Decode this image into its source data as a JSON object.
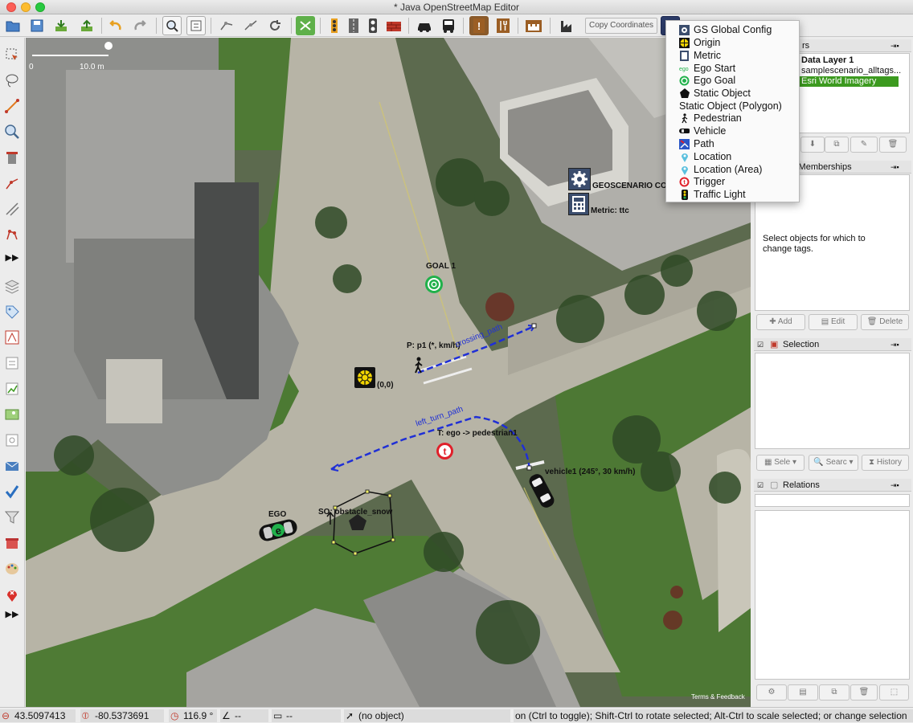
{
  "window": {
    "title": "* Java OpenStreetMap Editor"
  },
  "toolbar": {
    "copy_coordinates_label": "Copy Coordinates"
  },
  "map": {
    "scale_start": "0",
    "scale_end": "10.0 m",
    "labels": {
      "goal": "GOAL 1",
      "geoscenario_config": "GEOSCENARIO CO",
      "metric": "Metric: ttc",
      "pedestrian": "P: p1 (*, km/h)",
      "crossing_path": "crossing_path",
      "origin": "(0,0)",
      "left_turn_path": "left_turn_path",
      "trigger": "T: ego -> pedestrian1",
      "vehicle": "vehicle1 (245°, 30 km/h)",
      "ego": "EGO",
      "static_object": "SO: obstacle_snow",
      "attribution": "Terms & Feedback"
    }
  },
  "dropdown_menu": {
    "items": [
      {
        "label": "GS Global Config",
        "icon": "gear-icon",
        "indent": true
      },
      {
        "label": "Origin",
        "icon": "origin-icon",
        "indent": true
      },
      {
        "label": "Metric",
        "icon": "calculator-icon",
        "indent": true
      },
      {
        "label": "Ego Start",
        "icon": "ego-start-icon",
        "indent": true
      },
      {
        "label": "Ego Goal",
        "icon": "target-icon",
        "indent": true
      },
      {
        "label": "Static Object",
        "icon": "pentagon-icon",
        "indent": true
      },
      {
        "label": "Static Object (Polygon)",
        "icon": "",
        "indent": false
      },
      {
        "label": "Pedestrian",
        "icon": "pedestrian-icon",
        "indent": true
      },
      {
        "label": "Vehicle",
        "icon": "vehicle-icon",
        "indent": true
      },
      {
        "label": "Path",
        "icon": "path-icon",
        "indent": true
      },
      {
        "label": "Location",
        "icon": "location-pin-icon",
        "indent": true
      },
      {
        "label": "Location (Area)",
        "icon": "location-pin-icon",
        "indent": true
      },
      {
        "label": "Trigger",
        "icon": "trigger-icon",
        "indent": true
      },
      {
        "label": "Traffic Light",
        "icon": "traffic-light-icon",
        "indent": true
      }
    ]
  },
  "layers_panel": {
    "title_partial": "rs",
    "layers": [
      "Data Layer 1",
      "samplescenario_alltags...",
      "Esri World Imagery"
    ]
  },
  "tags_panel": {
    "title_partial": "s/Memberships",
    "empty_text": "Select objects for which to change tags.",
    "buttons": [
      "Add",
      "Edit",
      "Delete"
    ]
  },
  "selection_panel": {
    "title": "Selection",
    "buttons": [
      "Sele",
      "Searc",
      "History"
    ]
  },
  "relations_panel": {
    "title": "Relations"
  },
  "statusbar": {
    "lat": "43.5097413",
    "lon": "-80.5373691",
    "heading": "116.9 °",
    "angle": "--",
    "distance": "--",
    "object": "(no object)",
    "help": "on (Ctrl to toggle); Shift-Ctrl to rotate selected; Alt-Ctrl to scale selected; or change selection"
  },
  "colors": {
    "accent_green": "#3c9a1f",
    "path_blue": "#1f2fd6",
    "trigger_red": "#e0202a",
    "goal_green": "#21b14b"
  }
}
